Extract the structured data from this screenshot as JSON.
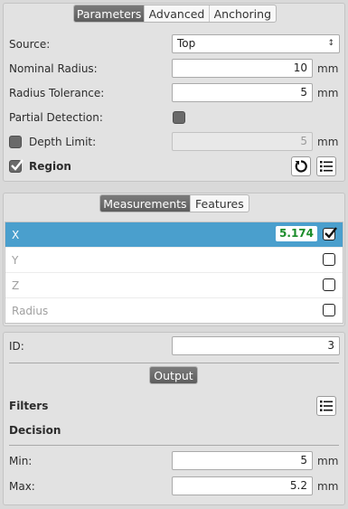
{
  "top_tabs": [
    "Parameters",
    "Advanced",
    "Anchoring"
  ],
  "params": {
    "source_label": "Source:",
    "source_value": "Top",
    "nominal_radius_label": "Nominal Radius:",
    "nominal_radius_value": "10",
    "radius_tolerance_label": "Radius Tolerance:",
    "radius_tolerance_value": "5",
    "partial_detection_label": "Partial Detection:",
    "depth_limit_label": "Depth Limit:",
    "depth_limit_value": "5",
    "region_label": "Region",
    "unit": "mm",
    "depth_limit_checked": false,
    "region_checked": true
  },
  "measure_tabs": [
    "Measurements",
    "Features"
  ],
  "measurements": [
    {
      "name": "X",
      "value": "5.174",
      "checked": true,
      "selected": true
    },
    {
      "name": "Y",
      "value": "",
      "checked": false,
      "selected": false
    },
    {
      "name": "Z",
      "value": "",
      "checked": false,
      "selected": false
    },
    {
      "name": "Radius",
      "value": "",
      "checked": false,
      "selected": false
    }
  ],
  "output_section": {
    "id_label": "ID:",
    "id_value": "3",
    "output_tab": "Output",
    "filters_label": "Filters",
    "decision_label": "Decision",
    "min_label": "Min:",
    "min_value": "5",
    "max_label": "Max:",
    "max_value": "5.2",
    "unit": "mm"
  },
  "colors": {
    "selected_row": "#4a9fcd",
    "value_green": "#1a8c2a"
  },
  "icons": {
    "refresh": "refresh-icon",
    "list": "list-icon",
    "check": "checkmark-icon"
  }
}
